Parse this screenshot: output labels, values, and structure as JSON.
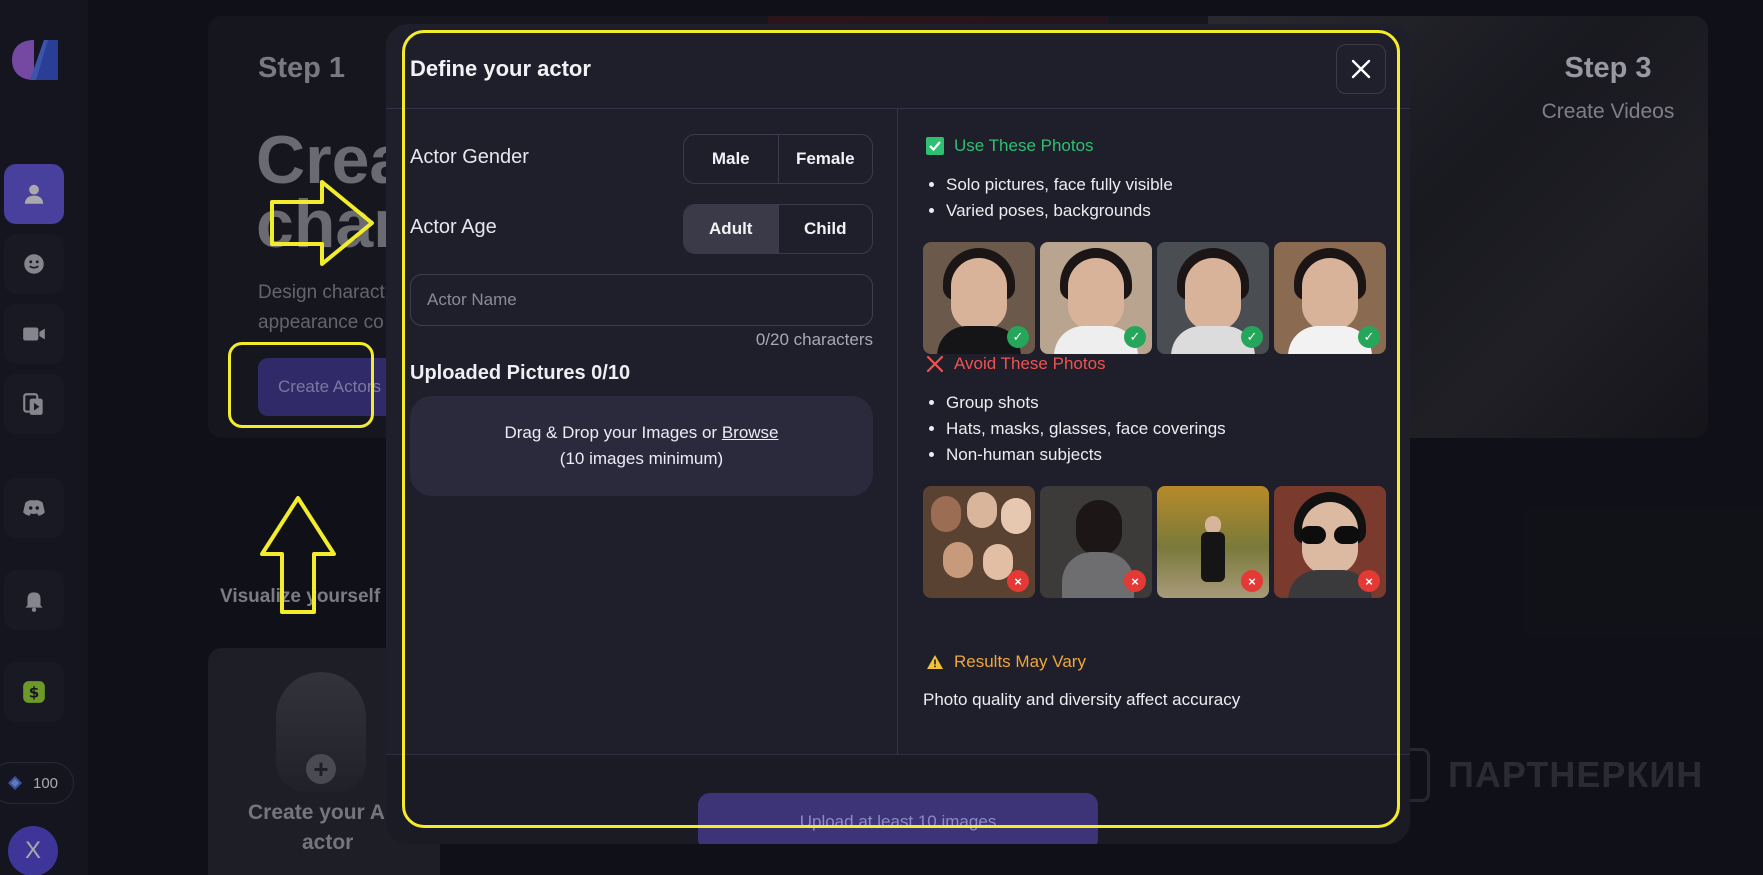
{
  "sidebar": {
    "credits": "100",
    "avatar_letter": "X",
    "items": [
      "actor-icon",
      "face-icon",
      "video-icon",
      "clips-icon",
      "discord-icon",
      "bell-icon",
      "dollar-icon"
    ]
  },
  "background": {
    "step1": "Step 1",
    "big_line1": "Crea",
    "big_line2": "chara",
    "desc_line1": "Design charact",
    "desc_line2": "appearance co",
    "create_btn": "Create Actors",
    "step3": "Step 3",
    "step3_sub": "Create Videos",
    "visualize": "Visualize yourself i",
    "actor_card_line1": "Create your A",
    "actor_card_line2": "actor",
    "watermark": "ПАРТНЕРКИН"
  },
  "modal": {
    "title": "Define your actor",
    "gender_label": "Actor Gender",
    "gender_options": [
      "Male",
      "Female"
    ],
    "age_label": "Actor Age",
    "age_options": [
      "Adult",
      "Child"
    ],
    "name_placeholder": "Actor Name",
    "char_count": "0/20 characters",
    "uploaded_title": "Uploaded Pictures 0/10",
    "drop_text": "Drag & Drop your Images or",
    "drop_browse": "Browse",
    "drop_min": "(10 images minimum)",
    "use_title": "Use These Photos",
    "use_bullets": [
      "Solo pictures, face fully visible",
      "Varied poses, backgrounds"
    ],
    "avoid_title": "Avoid These Photos",
    "avoid_bullets": [
      "Group shots",
      "Hats, masks, glasses, face coverings",
      "Non-human subjects"
    ],
    "warn_title": "Results May Vary",
    "warn_text": "Photo quality and diversity affect accuracy",
    "footer_btn": "Upload at least 10 images"
  },
  "colors": {
    "accent": "#6c5ce7",
    "ok": "#2fbf71",
    "bad": "#ef5350",
    "warn": "#f0a63a",
    "annotation": "#f3ec2c"
  }
}
